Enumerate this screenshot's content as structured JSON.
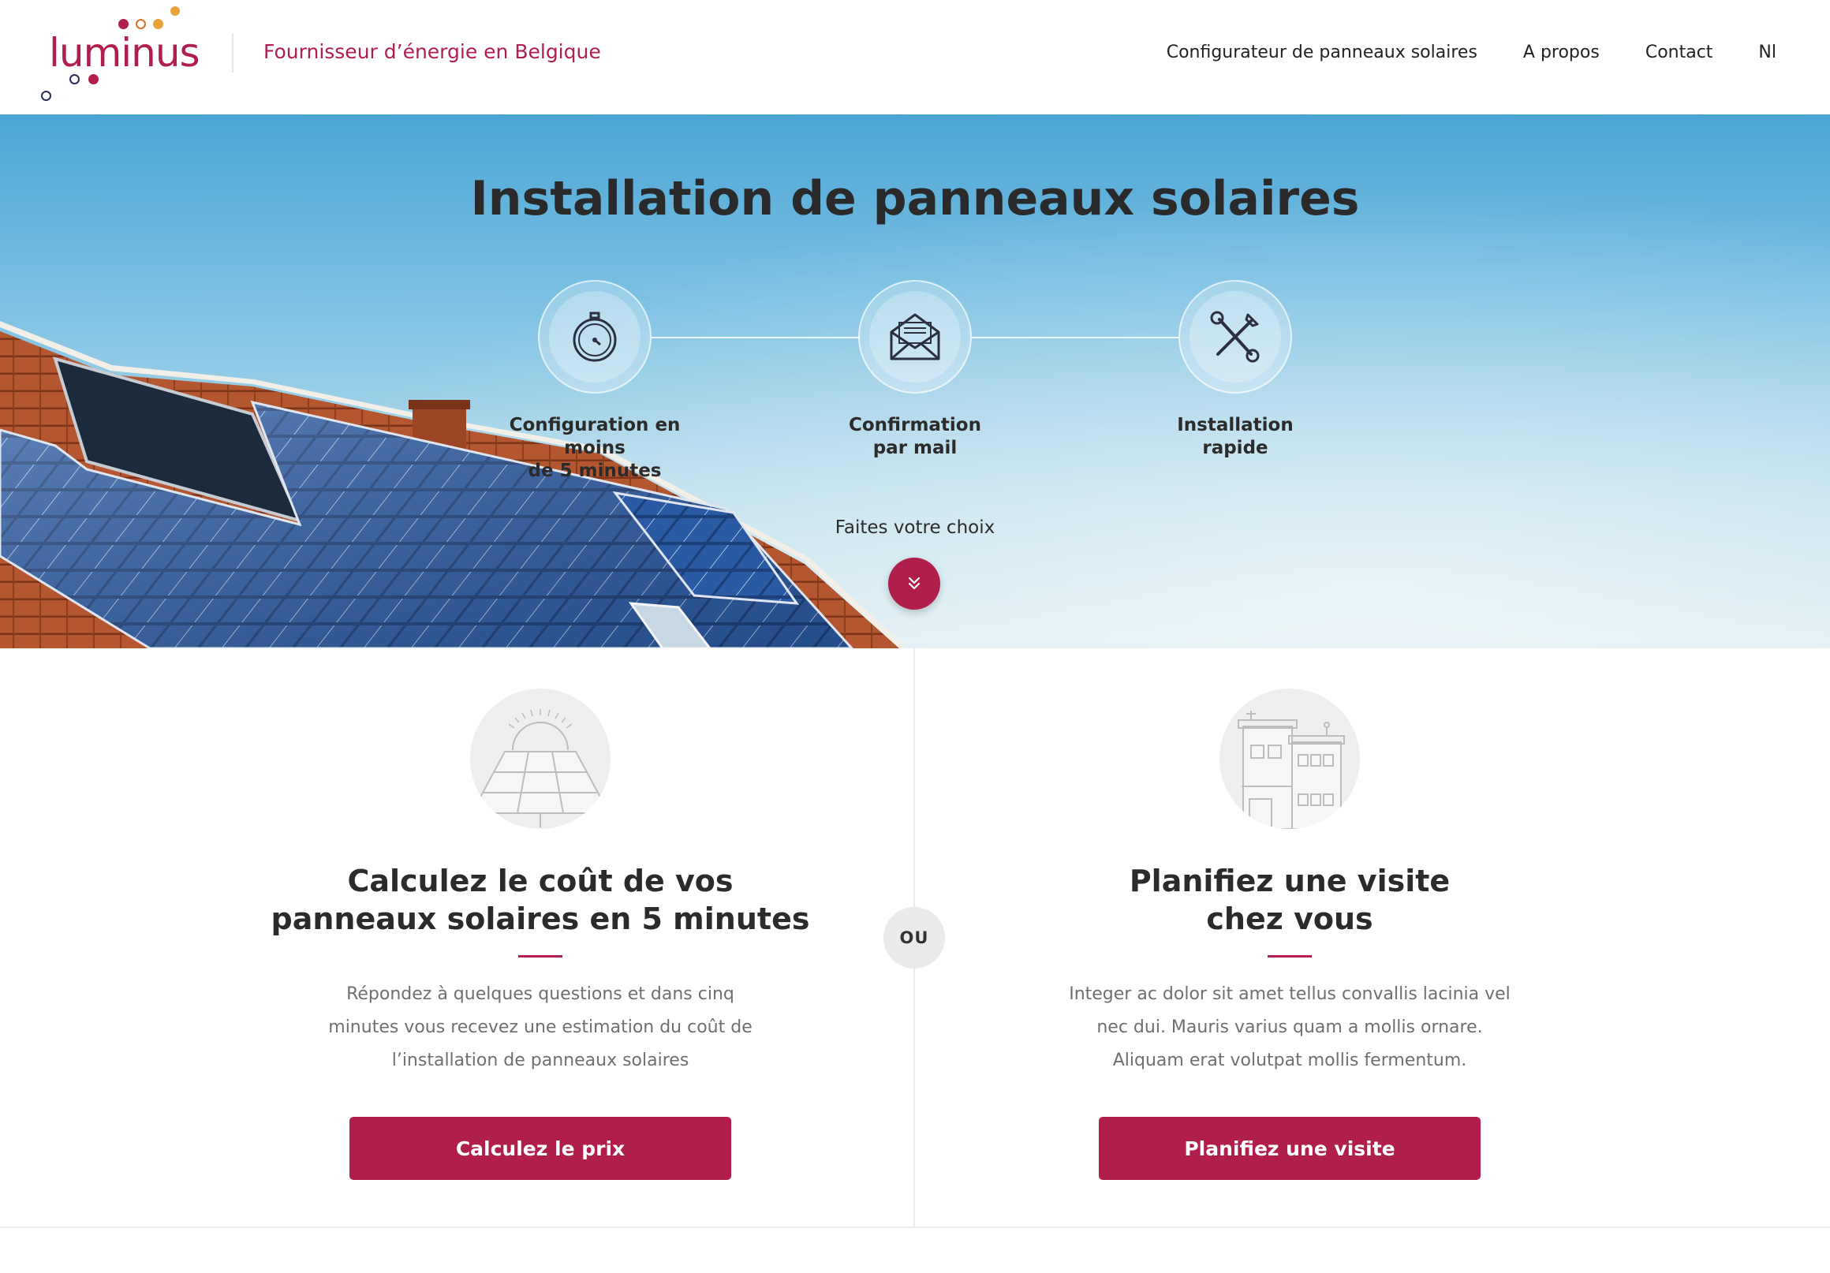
{
  "header": {
    "logo_text": "luminus",
    "tagline": "Fournisseur d’énergie en Belgique",
    "nav": [
      {
        "label": "Configurateur de panneaux solaires"
      },
      {
        "label": "A propos"
      },
      {
        "label": "Contact"
      },
      {
        "label": "Nl"
      }
    ]
  },
  "hero": {
    "title": "Installation de panneaux solaires",
    "steps": [
      {
        "icon": "stopwatch-icon",
        "label": "Configuration en moins\nde 5 minutes"
      },
      {
        "icon": "envelope-icon",
        "label": "Confirmation\npar mail"
      },
      {
        "icon": "tools-icon",
        "label": "Installation\nrapide"
      }
    ],
    "cta_text": "Faites votre choix",
    "cta_icon": "double-chevron-down-icon"
  },
  "options": {
    "separator": "OU",
    "left": {
      "icon": "solar-panel-icon",
      "title": "Calculez le coût de vos\npanneaux solaires en 5 minutes",
      "text": "Répondez à quelques questions et dans cinq minutes vous recevez une estimation du coût de l’installation de panneaux solaires",
      "button": "Calculez le prix"
    },
    "right": {
      "icon": "buildings-icon",
      "title": "Planifiez une visite\nchez vous",
      "text": "Integer ac dolor sit amet tellus convallis lacinia vel nec dui. Mauris varius quam a mollis ornare. Aliquam erat volutpat mollis fermentum.",
      "button": "Planifiez une visite"
    }
  },
  "colors": {
    "brand": "#b01f4c",
    "logo_dot_orange": "#e8a33b",
    "logo_dot_navy": "#2b2d5a"
  }
}
